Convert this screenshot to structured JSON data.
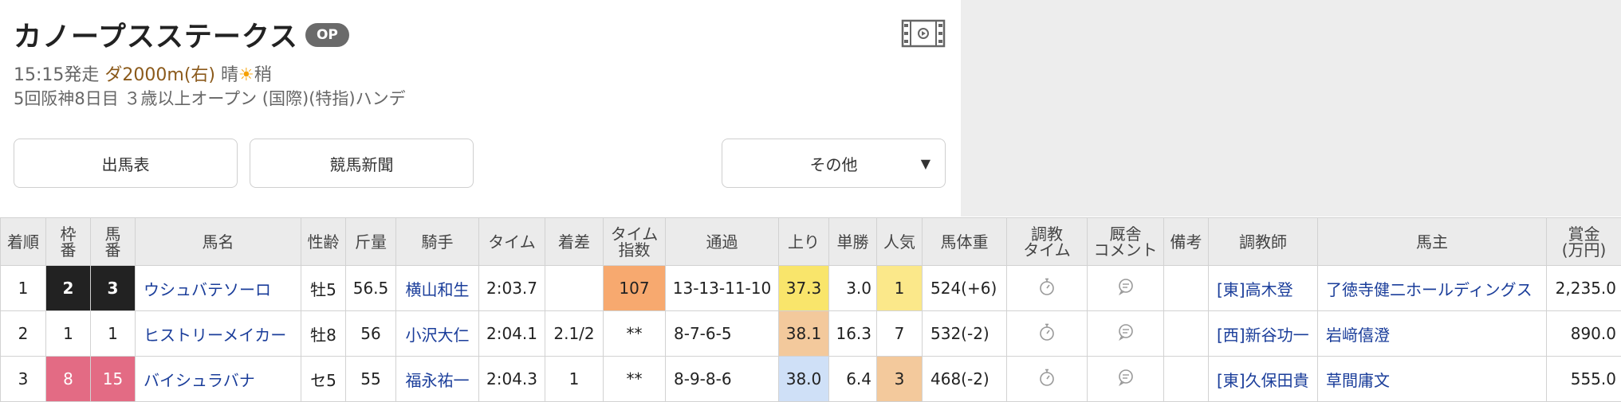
{
  "race": {
    "title": "カノープスステークス",
    "grade": "OP",
    "start_time": "15:15発走",
    "distance": "ダ2000m(右)",
    "weather": "晴",
    "weather_icon": "sun-icon",
    "track_condition": "稍",
    "details": "5回阪神8日目 ３歳以上オープン (国際)(特指)ハンデ"
  },
  "buttons": {
    "shutuba": "出馬表",
    "shinbun": "競馬新聞",
    "other": "その他"
  },
  "table": {
    "headers": {
      "rank": "着順",
      "waku": [
        "枠",
        "番"
      ],
      "umaban": [
        "馬",
        "番"
      ],
      "name": "馬名",
      "sexage": "性齢",
      "weight": "斤量",
      "jockey": "騎手",
      "time": "タイム",
      "margin": "着差",
      "time_index": [
        "タイム",
        "指数"
      ],
      "passing": "通過",
      "last3f": "上り",
      "odds": "単勝",
      "popularity": "人気",
      "horse_weight": "馬体重",
      "training_time": [
        "調教",
        "タイム"
      ],
      "stable_comment": [
        "厩舎",
        "コメント"
      ],
      "notes": "備考",
      "trainer": "調教師",
      "owner": "馬主",
      "prize": [
        "賞金",
        "(万円)"
      ]
    },
    "rows": [
      {
        "rank": "1",
        "waku": "2",
        "umaban": "3",
        "name": "ウシュバテソーロ",
        "sexage": "牡5",
        "weight": "56.5",
        "jockey": "横山和生",
        "time": "2:03.7",
        "margin": "",
        "time_index": "107",
        "passing": "13-13-11-10",
        "last3f": "37.3",
        "odds": "3.0",
        "popularity": "1",
        "horse_weight": "524(+6)",
        "trainer": "[東]高木登",
        "owner": "了徳寺健二ホールディングス",
        "prize": "2,235.0",
        "colors": {
          "waku_bg": "#222222",
          "waku_fg": "#ffffff",
          "index_bg": "#f7a96f",
          "last3f_bg": "#f9e56b",
          "pop_bg": "#fbe88a"
        }
      },
      {
        "rank": "2",
        "waku": "1",
        "umaban": "1",
        "name": "ヒストリーメイカー",
        "sexage": "牡8",
        "weight": "56",
        "jockey": "小沢大仁",
        "time": "2:04.1",
        "margin": "2.1/2",
        "time_index": "**",
        "passing": "8-7-6-5",
        "last3f": "38.1",
        "odds": "16.3",
        "popularity": "7",
        "horse_weight": "532(-2)",
        "trainer": "[西]新谷功一",
        "owner": "岩﨑僖澄",
        "prize": "890.0",
        "colors": {
          "waku_bg": "#ffffff",
          "waku_fg": "#222222",
          "index_bg": "#ffffff",
          "last3f_bg": "#f3c99c",
          "pop_bg": "#ffffff"
        }
      },
      {
        "rank": "3",
        "waku": "8",
        "umaban": "15",
        "name": "バイシュラバナ",
        "sexage": "セ5",
        "weight": "55",
        "jockey": "福永祐一",
        "time": "2:04.3",
        "margin": "1",
        "time_index": "**",
        "passing": "8-9-8-6",
        "last3f": "38.0",
        "odds": "6.4",
        "popularity": "3",
        "horse_weight": "468(-2)",
        "trainer": "[東]久保田貴",
        "owner": "草間庸文",
        "prize": "555.0",
        "colors": {
          "waku_bg": "#e36b84",
          "waku_fg": "#ffffff",
          "index_bg": "#ffffff",
          "last3f_bg": "#cfe0f7",
          "pop_bg": "#f3c99c"
        }
      }
    ]
  },
  "icons": {
    "video": "video-film-icon",
    "training": "stopwatch-icon",
    "comment": "comment-bubble-icon",
    "dropdown": "caret-down-icon"
  }
}
